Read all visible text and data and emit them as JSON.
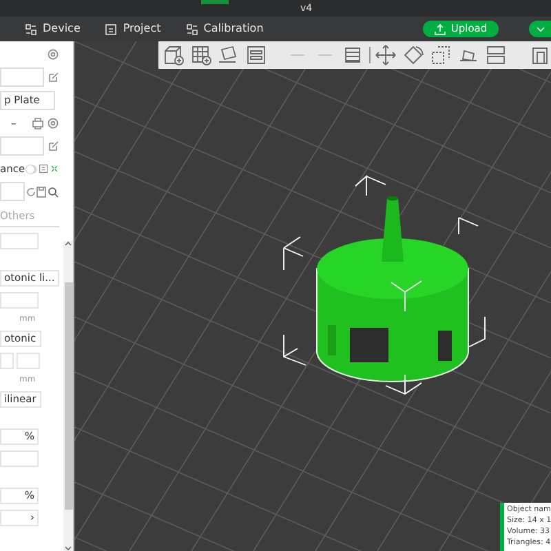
{
  "window": {
    "title": "v4"
  },
  "tabs": [
    {
      "label": "Device",
      "selected": false
    },
    {
      "label": "Project",
      "selected": false
    },
    {
      "label": "Calibration",
      "selected": false
    }
  ],
  "upload": {
    "label": "Upload"
  },
  "panel": [
    {
      "kind": "header"
    },
    {
      "kind": "preset"
    },
    {
      "kind": "plate",
      "value": "p Plate"
    },
    {
      "kind": "printer",
      "label": "–"
    },
    {
      "kind": "preset"
    },
    {
      "kind": "toggle",
      "label": "ance",
      "on": false
    },
    {
      "kind": "process"
    },
    {
      "kind": "tab",
      "label": "Others"
    },
    {
      "kind": "setting"
    },
    {
      "kind": "gap"
    },
    {
      "kind": "setting",
      "value": "otonic li..."
    },
    {
      "kind": "setting"
    },
    {
      "kind": "unit",
      "label": "mm"
    },
    {
      "kind": "setting",
      "value": "otonic"
    },
    {
      "kind": "pair"
    },
    {
      "kind": "unit",
      "label": "mm"
    },
    {
      "kind": "setting",
      "value": "ilinear"
    },
    {
      "kind": "gap"
    },
    {
      "kind": "setting",
      "unit": "%"
    },
    {
      "kind": "setting"
    },
    {
      "kind": "gap"
    },
    {
      "kind": "setting",
      "unit": "%"
    },
    {
      "kind": "setting",
      "unit": "›"
    }
  ],
  "toolbar_buttons": [
    {
      "disabled": false
    },
    {
      "disabled": false
    },
    {
      "disabled": false
    },
    {
      "disabled": false
    },
    {
      "disabled": true
    },
    {
      "disabled": true
    },
    {
      "disabled": false
    },
    {
      "disabled": false
    },
    {
      "disabled": false
    },
    {
      "disabled": false
    },
    {
      "disabled": false
    },
    {
      "disabled": false
    },
    {
      "disabled": false
    }
  ],
  "object_info": [
    "Object nam",
    "Size: 14 x 1",
    "Volume: 33",
    "Triangles: 4"
  ]
}
